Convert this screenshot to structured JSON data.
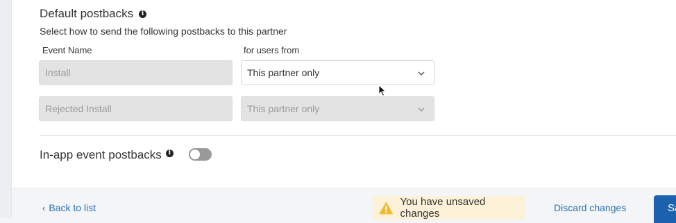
{
  "section": {
    "title": "Default postbacks",
    "subtitle": "Select how to send the following postbacks to this partner"
  },
  "columns": {
    "event": "Event Name",
    "users": "for users from"
  },
  "rows": [
    {
      "event": "Install",
      "users": "This partner only",
      "users_enabled": true
    },
    {
      "event": "Rejected Install",
      "users": "This partner only",
      "users_enabled": false
    }
  ],
  "inapp": {
    "title": "In-app event postbacks",
    "toggle_on": false
  },
  "footer": {
    "back": "Back to list",
    "unsaved": "You have unsaved changes",
    "discard": "Discard changes",
    "save": "Sa"
  },
  "colors": {
    "link": "#2a6fb5",
    "primary": "#1d62ad",
    "warning_bg": "#fdf1d7",
    "warning_icon": "#f2b82f"
  },
  "icons": [
    "info-icon",
    "chevron-down-icon",
    "chevron-left-icon",
    "warning-icon",
    "cursor-icon"
  ]
}
